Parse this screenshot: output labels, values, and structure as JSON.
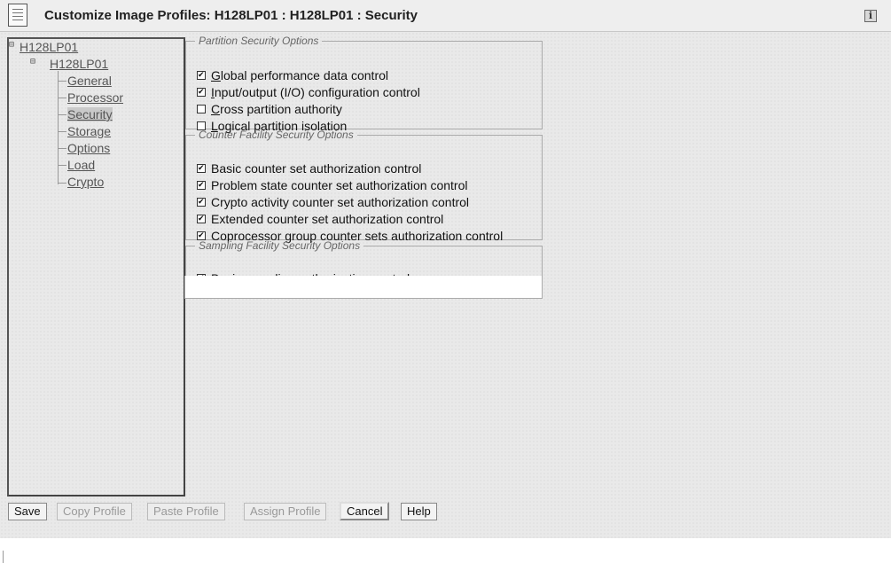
{
  "window": {
    "title": "Customize Image Profiles: H128LP01 : H128LP01 : Security"
  },
  "icons": {
    "title_icon": "document-icon",
    "info_icon": "info-icon",
    "info_glyph": "i"
  },
  "tree": {
    "root": {
      "label": "H128LP01",
      "expander": "⊟"
    },
    "child": {
      "label": "H128LP01",
      "expander": "⊟"
    },
    "items": [
      {
        "label": "General"
      },
      {
        "label": "Processor"
      },
      {
        "label": "Security"
      },
      {
        "label": "Storage"
      },
      {
        "label": "Options"
      },
      {
        "label": "Load"
      },
      {
        "label": "Crypto"
      }
    ],
    "selected": "Security"
  },
  "partition_security": {
    "legend": "Partition Security Options",
    "options": [
      {
        "mnemonic": "G",
        "rest": "lobal performance data control",
        "checked": true
      },
      {
        "mnemonic": "I",
        "rest": "nput/output (I/O) configuration control",
        "checked": true
      },
      {
        "mnemonic": "C",
        "rest": "ross partition authority",
        "checked": false
      },
      {
        "mnemonic": "L",
        "rest": "ogical partition isolation",
        "checked": false
      }
    ]
  },
  "counter_security": {
    "legend": "Counter Facility Security Options",
    "options": [
      {
        "label": "Basic counter set authorization control",
        "checked": true
      },
      {
        "label": "Problem state counter set authorization control",
        "checked": true
      },
      {
        "label": "Crypto activity counter set authorization control",
        "checked": true
      },
      {
        "label": "Extended counter set authorization control",
        "checked": true
      },
      {
        "label": "Coprocessor group counter sets authorization control",
        "checked": true
      }
    ]
  },
  "sampling_security": {
    "legend": "Sampling Facility Security Options",
    "options": [
      {
        "label": "Basic sampling authorization control",
        "checked": true
      }
    ]
  },
  "buttons": {
    "save": "Save",
    "copy_profile": "Copy Profile",
    "paste_profile": "Paste Profile",
    "assign_profile": "Assign Profile",
    "cancel": "Cancel",
    "help": "Help"
  }
}
